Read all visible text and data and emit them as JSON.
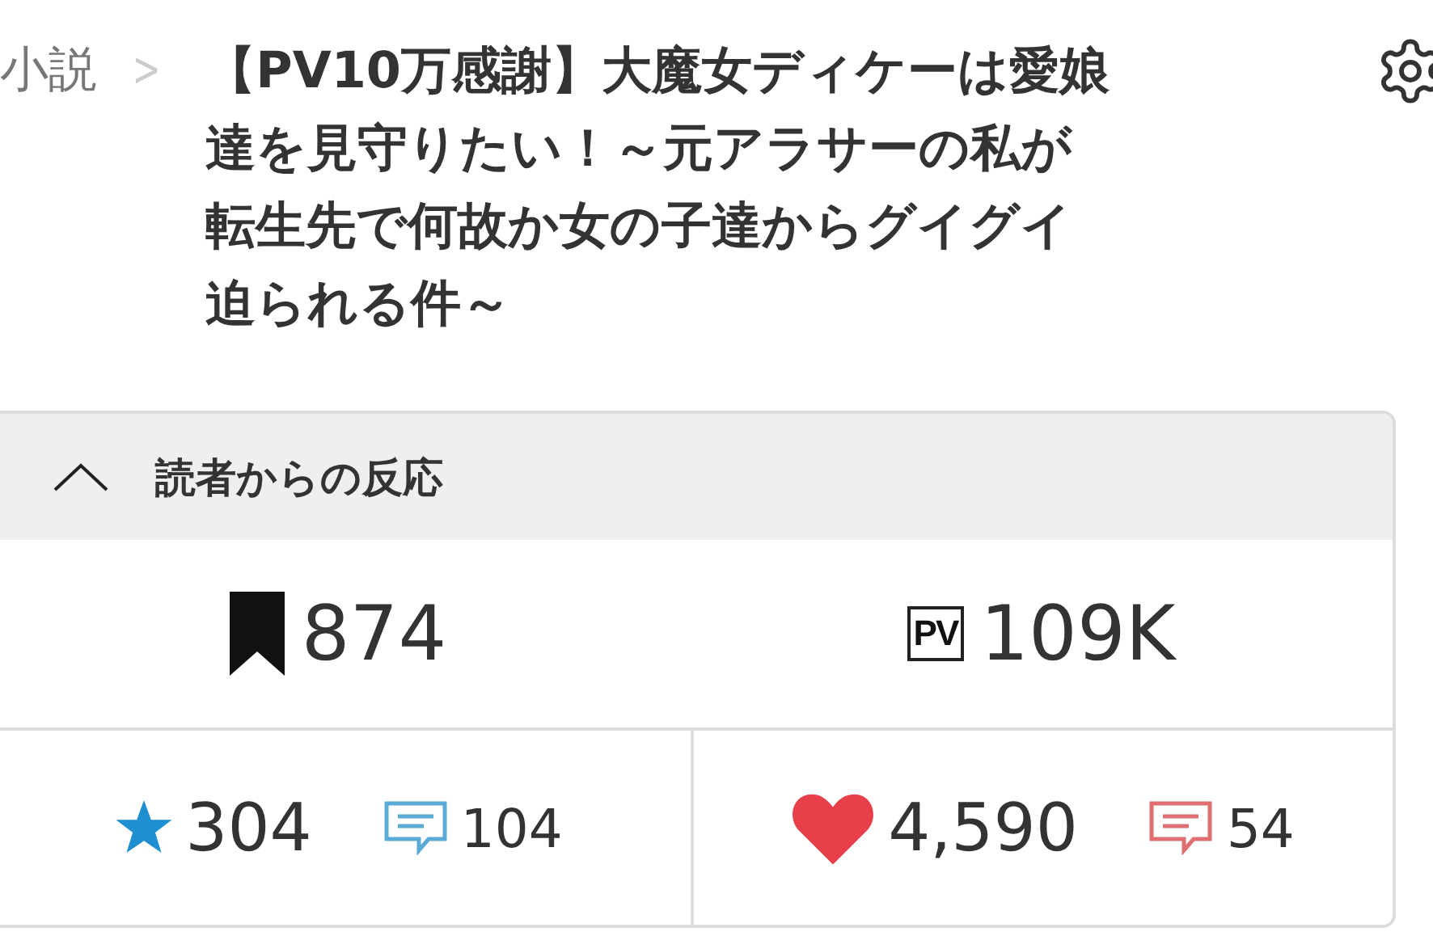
{
  "breadcrumb": {
    "label": "小説",
    "separator": ">"
  },
  "title_lines": [
    "【PV10万感謝】大魔女ディケーは愛娘",
    "達を見守りたい！～元アラサーの私が",
    "転生先で何故か女の子達からグイグイ",
    "迫られる件～"
  ],
  "reactions": {
    "title": "読者からの反応",
    "expanded": true,
    "bookmarks": "874",
    "pv_badge": "PV",
    "page_views": "109K",
    "stars": "304",
    "star_comments": "104",
    "hearts": "4,590",
    "heart_comments": "54"
  }
}
